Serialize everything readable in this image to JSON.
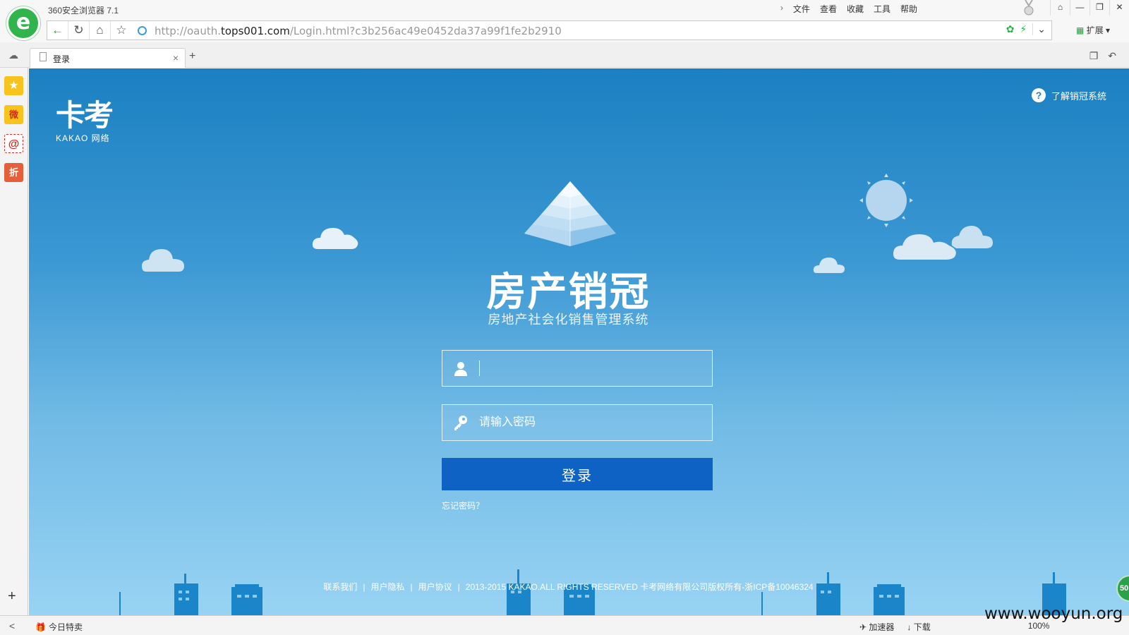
{
  "browser": {
    "app_title": "360安全浏览器 7.1",
    "logo_glyph": "e",
    "menu": [
      "文件",
      "查看",
      "收藏",
      "工具",
      "帮助"
    ],
    "window_controls": [
      "⌂",
      "—",
      "❐",
      "✕"
    ],
    "url_prefix": "http://oauth.",
    "url_domain": "tops001.com",
    "url_path": "/Login.html?c3b256ac49e0452da37a99f1fe2b2910",
    "extensions_label": "扩展",
    "tab_label": "登录",
    "side_icons": [
      "★",
      "微",
      "@",
      "折"
    ],
    "status_back": "<",
    "status_deal": "今日特卖",
    "status_items": [
      "加速器",
      "下载",
      "100%"
    ],
    "watermark": "www.wooyun.org",
    "bubble": "50"
  },
  "page": {
    "logo_big": "卡考",
    "logo_small": "KAKAO 网络",
    "about_label": "了解销冠系统",
    "app_name": "房产销冠",
    "app_subtitle": "房地产社会化销售管理系统",
    "username_value": "",
    "password_placeholder": "请输入密码",
    "login_button": "登录",
    "forgot_link": "忘记密码？",
    "footer_links": [
      "联系我们",
      "用户隐私",
      "用户协议"
    ],
    "footer_copyright": "2013-2015 KAKAO.ALL RIGHTS RESERVED 卡考网络有限公司版权所有-浙ICP备10046324"
  },
  "colors": {
    "sky_top": "#1b80c1",
    "sky_bottom": "#98d3f3",
    "login_button": "#0d62c4",
    "browser_green": "#31b44b"
  }
}
